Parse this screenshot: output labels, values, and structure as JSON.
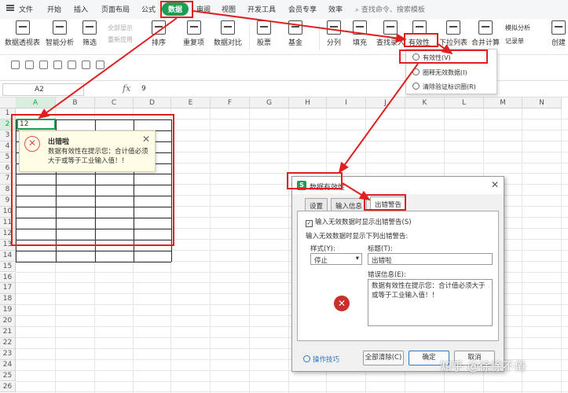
{
  "menu": {
    "items": [
      "文件",
      "开始",
      "插入",
      "页面布局",
      "公式",
      "数据",
      "审阅",
      "视图",
      "开发工具",
      "会员专享",
      "效率"
    ],
    "active": "数据",
    "search_placeholder": "查找命令、搜索模板"
  },
  "ribbon": {
    "buttons": [
      "数据透视表",
      "智能分析",
      "筛选",
      "排序",
      "重复项",
      "数据对比",
      "股票",
      "基金",
      "分列",
      "填充",
      "查找录入",
      "有效性",
      "下拉列表",
      "合并计算",
      "模拟分析",
      "记录单",
      "创建"
    ],
    "small_buttons": [
      "全部显示",
      "重新应用"
    ]
  },
  "validity_menu": {
    "items": [
      "有效性(V)",
      "圈释无效数据(I)",
      "清除验证标识圈(R)"
    ]
  },
  "formula_bar": {
    "name_box": "A2",
    "fx_label": "fx",
    "value": "9"
  },
  "sheet": {
    "columns": [
      "A",
      "B",
      "C",
      "D",
      "E",
      "F",
      "G",
      "H",
      "I",
      "J",
      "K",
      "L",
      "M",
      "N"
    ],
    "rows": [
      "1",
      "2",
      "3",
      "4",
      "5",
      "6",
      "7",
      "8",
      "9",
      "10",
      "11",
      "12",
      "13",
      "14",
      "15",
      "16",
      "17",
      "18",
      "19",
      "20",
      "21",
      "22",
      "23",
      "24",
      "25",
      "26"
    ],
    "a2_value": "12"
  },
  "error_tooltip": {
    "title": "出错啦",
    "message": "数据有效性在提示您：合计值必须大于或等于工业输入值！！",
    "close": "✕"
  },
  "dialog": {
    "title": "数据有效性",
    "logo": "S",
    "close": "✕",
    "tabs": [
      "设置",
      "输入信息",
      "出错警告"
    ],
    "active_tab": "出错警告",
    "show_error_checkbox": "输入无效数据时显示出错警告(S)",
    "section_label": "输入无效数据时显示下列出错警告:",
    "style_label": "样式(Y):",
    "style_value": "停止",
    "title_label": "标题(T):",
    "title_value": "出错啦",
    "message_label": "错误信息(E):",
    "message_value": "数据有效性在提示您：合计值必须大于或等于工业输入值！！",
    "tips": "操作技巧",
    "buttons": {
      "clear": "全部清除(C)",
      "ok": "确定",
      "cancel": "取消"
    }
  },
  "watermark": "知乎 @徐徐不倦",
  "colors": {
    "accent_green": "#1e9e54",
    "highlight_red": "#e02020"
  }
}
